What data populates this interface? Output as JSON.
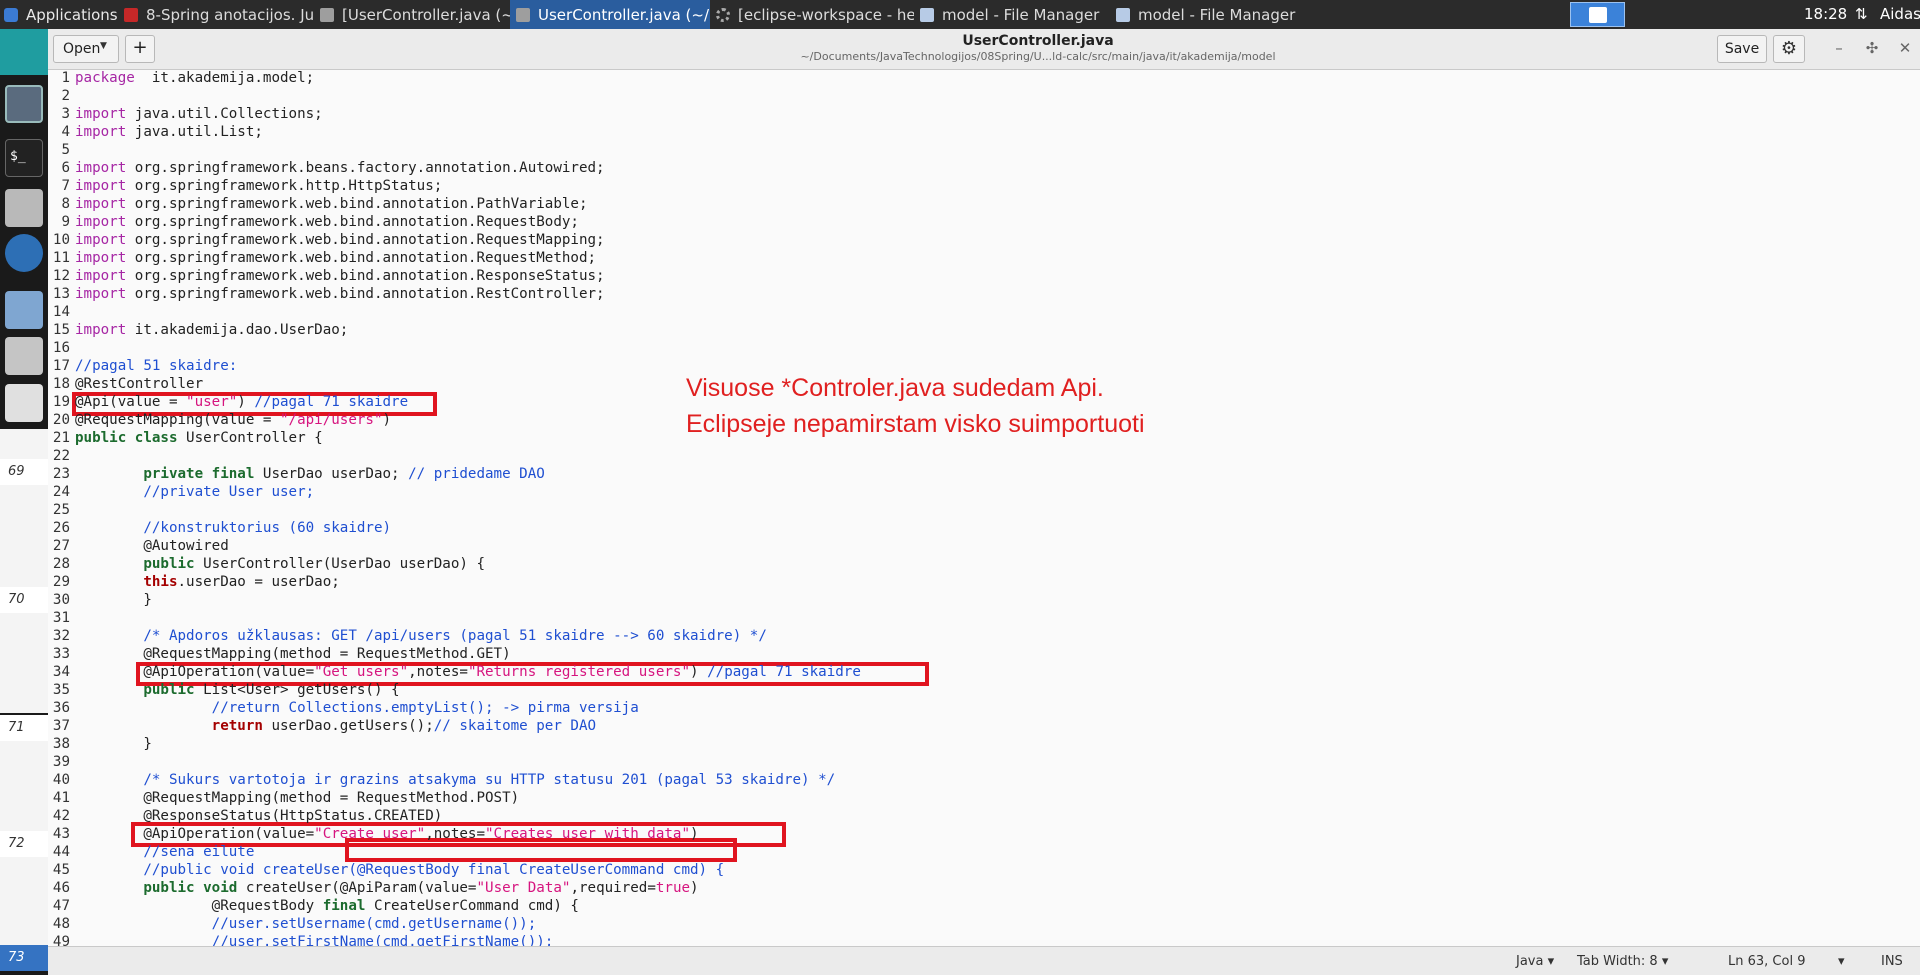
{
  "taskbar": {
    "apps_label": "Applications",
    "tasks": [
      {
        "label": "8-Spring anotacijos. Jun...",
        "icon": "pdf-icon"
      },
      {
        "label": "[UserController.java (~...",
        "icon": "text-editor-icon"
      },
      {
        "label": "UserController.java (~/...",
        "icon": "text-editor-icon"
      },
      {
        "label": "[eclipse-workspace - he...",
        "icon": "eclipse-icon"
      },
      {
        "label": "model - File Manager",
        "icon": "folder-icon"
      },
      {
        "label": "model - File Manager",
        "icon": "folder-icon"
      }
    ],
    "clock": "18:28",
    "user": "Aidas"
  },
  "dock": {
    "slide_numbers": [
      "69",
      "70",
      "71",
      "72",
      "73"
    ],
    "terminal_label": "$_"
  },
  "header": {
    "open_label": "Open",
    "new_label": "+",
    "title": "UserController.java",
    "path": "~/Documents/JavaTechnologijos/08Spring/U...ld-calc/src/main/java/it/akademija/model",
    "save_label": "Save"
  },
  "code_lines": [
    {
      "n": "1",
      "parts": [
        [
          "kw",
          "package"
        ],
        [
          "",
          "  it.akademija.model;"
        ]
      ]
    },
    {
      "n": "2",
      "parts": []
    },
    {
      "n": "3",
      "parts": [
        [
          "kw",
          "import"
        ],
        [
          "",
          " java.util.Collections;"
        ]
      ]
    },
    {
      "n": "4",
      "parts": [
        [
          "kw",
          "import"
        ],
        [
          "",
          " java.util.List;"
        ]
      ]
    },
    {
      "n": "5",
      "parts": []
    },
    {
      "n": "6",
      "parts": [
        [
          "kw",
          "import"
        ],
        [
          "",
          " org.springframework.beans.factory.annotation.Autowired;"
        ]
      ]
    },
    {
      "n": "7",
      "parts": [
        [
          "kw",
          "import"
        ],
        [
          "",
          " org.springframework.http.HttpStatus;"
        ]
      ]
    },
    {
      "n": "8",
      "parts": [
        [
          "kw",
          "import"
        ],
        [
          "",
          " org.springframework.web.bind.annotation.PathVariable;"
        ]
      ]
    },
    {
      "n": "9",
      "parts": [
        [
          "kw",
          "import"
        ],
        [
          "",
          " org.springframework.web.bind.annotation.RequestBody;"
        ]
      ]
    },
    {
      "n": "10",
      "parts": [
        [
          "kw",
          "import"
        ],
        [
          "",
          " org.springframework.web.bind.annotation.RequestMapping;"
        ]
      ]
    },
    {
      "n": "11",
      "parts": [
        [
          "kw",
          "import"
        ],
        [
          "",
          " org.springframework.web.bind.annotation.RequestMethod;"
        ]
      ]
    },
    {
      "n": "12",
      "parts": [
        [
          "kw",
          "import"
        ],
        [
          "",
          " org.springframework.web.bind.annotation.ResponseStatus;"
        ]
      ]
    },
    {
      "n": "13",
      "parts": [
        [
          "kw",
          "import"
        ],
        [
          "",
          " org.springframework.web.bind.annotation.RestController;"
        ]
      ]
    },
    {
      "n": "14",
      "parts": []
    },
    {
      "n": "15",
      "parts": [
        [
          "kw",
          "import"
        ],
        [
          "",
          " it.akademija.dao.UserDao;"
        ]
      ]
    },
    {
      "n": "16",
      "parts": []
    },
    {
      "n": "17",
      "parts": [
        [
          "cm",
          "//pagal 51 skaidre:"
        ]
      ]
    },
    {
      "n": "18",
      "parts": [
        [
          "",
          "@RestController"
        ]
      ]
    },
    {
      "n": "19",
      "parts": [
        [
          "",
          "@Api(value = "
        ],
        [
          "str",
          "\"user\""
        ],
        [
          "",
          ") "
        ],
        [
          "cm",
          "//pagal 71 skaidre"
        ]
      ]
    },
    {
      "n": "20",
      "parts": [
        [
          "",
          "@RequestMapping(value = "
        ],
        [
          "str",
          "\"/api/users\""
        ],
        [
          "",
          ")"
        ]
      ]
    },
    {
      "n": "21",
      "parts": [
        [
          "kwb",
          "public class"
        ],
        [
          "",
          " UserController {"
        ]
      ]
    },
    {
      "n": "22",
      "parts": []
    },
    {
      "n": "23",
      "parts": [
        [
          "",
          "        "
        ],
        [
          "kwb",
          "private final"
        ],
        [
          "",
          " UserDao userDao; "
        ],
        [
          "cm",
          "// pridedame DAO"
        ]
      ]
    },
    {
      "n": "24",
      "parts": [
        [
          "",
          "        "
        ],
        [
          "cm",
          "//private User user;"
        ]
      ]
    },
    {
      "n": "25",
      "parts": []
    },
    {
      "n": "26",
      "parts": [
        [
          "",
          "        "
        ],
        [
          "cm",
          "//konstruktorius (60 skaidre)"
        ]
      ]
    },
    {
      "n": "27",
      "parts": [
        [
          "",
          "        @Autowired"
        ]
      ]
    },
    {
      "n": "28",
      "parts": [
        [
          "",
          "        "
        ],
        [
          "kwb",
          "public"
        ],
        [
          "",
          " UserController(UserDao userDao) {"
        ]
      ]
    },
    {
      "n": "29",
      "parts": [
        [
          "",
          "        "
        ],
        [
          "kwr",
          "this"
        ],
        [
          "",
          ".userDao = userDao;"
        ]
      ]
    },
    {
      "n": "30",
      "parts": [
        [
          "",
          "        }"
        ]
      ]
    },
    {
      "n": "31",
      "parts": []
    },
    {
      "n": "32",
      "parts": [
        [
          "",
          "        "
        ],
        [
          "cm",
          "/* Apdoros užklausas: GET /api/users (pagal 51 skaidre --> 60 skaidre) */"
        ]
      ]
    },
    {
      "n": "33",
      "parts": [
        [
          "",
          "        @RequestMapping(method = RequestMethod.GET)"
        ]
      ]
    },
    {
      "n": "34",
      "parts": [
        [
          "",
          "        @ApiOperation(value="
        ],
        [
          "str",
          "\"Get users\""
        ],
        [
          "",
          ",notes="
        ],
        [
          "str",
          "\"Returns registered users\""
        ],
        [
          "",
          ") "
        ],
        [
          "cm",
          "//pagal 71 skaidre"
        ]
      ]
    },
    {
      "n": "35",
      "parts": [
        [
          "",
          "        "
        ],
        [
          "kwb",
          "public"
        ],
        [
          "",
          " List<User> getUsers() {"
        ]
      ]
    },
    {
      "n": "36",
      "parts": [
        [
          "",
          "                "
        ],
        [
          "cm",
          "//return Collections.emptyList(); -> pirma versija"
        ]
      ]
    },
    {
      "n": "37",
      "parts": [
        [
          "",
          "                "
        ],
        [
          "kwr",
          "return"
        ],
        [
          "",
          " userDao.getUsers();"
        ],
        [
          "cm",
          "// skaitome per DAO"
        ]
      ]
    },
    {
      "n": "38",
      "parts": [
        [
          "",
          "        }"
        ]
      ]
    },
    {
      "n": "39",
      "parts": []
    },
    {
      "n": "40",
      "parts": [
        [
          "",
          "        "
        ],
        [
          "cm",
          "/* Sukurs vartotoja ir grazins atsakyma su HTTP statusu 201 (pagal 53 skaidre) */"
        ]
      ]
    },
    {
      "n": "41",
      "parts": [
        [
          "",
          "        @RequestMapping(method = RequestMethod.POST)"
        ]
      ]
    },
    {
      "n": "42",
      "parts": [
        [
          "",
          "        @ResponseStatus(HttpStatus.CREATED)"
        ]
      ]
    },
    {
      "n": "43",
      "parts": [
        [
          "",
          "        @ApiOperation(value="
        ],
        [
          "str",
          "\"Create user\""
        ],
        [
          "",
          ",notes="
        ],
        [
          "str",
          "\"Creates user with data\""
        ],
        [
          "",
          ")"
        ]
      ]
    },
    {
      "n": "44",
      "parts": [
        [
          "",
          "        "
        ],
        [
          "cm",
          "//sena eilute"
        ]
      ]
    },
    {
      "n": "45",
      "parts": [
        [
          "",
          "        "
        ],
        [
          "cm",
          "//public void createUser(@RequestBody final CreateUserCommand cmd) {"
        ]
      ]
    },
    {
      "n": "46",
      "parts": [
        [
          "",
          "        "
        ],
        [
          "kwb",
          "public void"
        ],
        [
          "",
          " createUser(@ApiParam(value="
        ],
        [
          "str",
          "\"User Data\""
        ],
        [
          "",
          ",required="
        ],
        [
          "str",
          "true"
        ],
        [
          "",
          ")"
        ]
      ]
    },
    {
      "n": "47",
      "parts": [
        [
          "",
          "                @RequestBody "
        ],
        [
          "kwb",
          "final"
        ],
        [
          "",
          " CreateUserCommand cmd) {"
        ]
      ]
    },
    {
      "n": "48",
      "parts": [
        [
          "",
          "                "
        ],
        [
          "cm",
          "//user.setUsername(cmd.getUsername());"
        ]
      ]
    },
    {
      "n": "49",
      "parts": [
        [
          "",
          "                "
        ],
        [
          "cm",
          "//user.setFirstName(cmd.getFirstName());"
        ]
      ]
    }
  ],
  "annotation": {
    "line1": "Visuose *Controler.java sudedam Api.",
    "line2": "Eclipseje nepamirstam visko suimportuoti"
  },
  "status": {
    "language": "Java",
    "tab_width": "Tab Width: 8",
    "position": "Ln 63, Col 9",
    "mode": "INS"
  },
  "colors": {
    "highlight_box": "#e0141f",
    "keyword": "#a626a4",
    "string": "#d6157f",
    "comment": "#1f4fd1"
  }
}
